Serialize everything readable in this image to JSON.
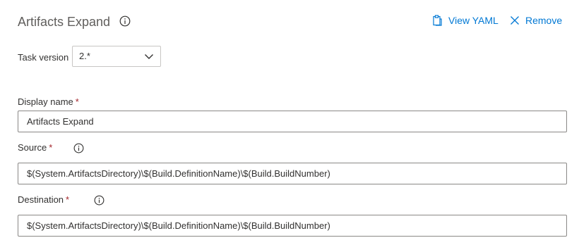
{
  "header": {
    "title": "Artifacts Expand",
    "view_yaml": "View YAML",
    "remove": "Remove"
  },
  "task_version": {
    "label": "Task version",
    "value": "2.*"
  },
  "fields": {
    "display_name": {
      "label": "Display name",
      "required": "*",
      "value": "Artifacts Expand"
    },
    "source": {
      "label": "Source",
      "required": "*",
      "value": "$(System.ArtifactsDirectory)\\$(Build.DefinitionName)\\$(Build.BuildNumber)"
    },
    "destination": {
      "label": "Destination",
      "required": "*",
      "value": "$(System.ArtifactsDirectory)\\$(Build.DefinitionName)\\$(Build.BuildNumber)"
    }
  },
  "icons": {
    "info": "info-icon",
    "clipboard": "clipboard-icon",
    "close": "close-icon",
    "chevron": "chevron-down-icon"
  },
  "colors": {
    "accent": "#0078d4",
    "required": "#a4262c",
    "title": "#605e5c"
  }
}
